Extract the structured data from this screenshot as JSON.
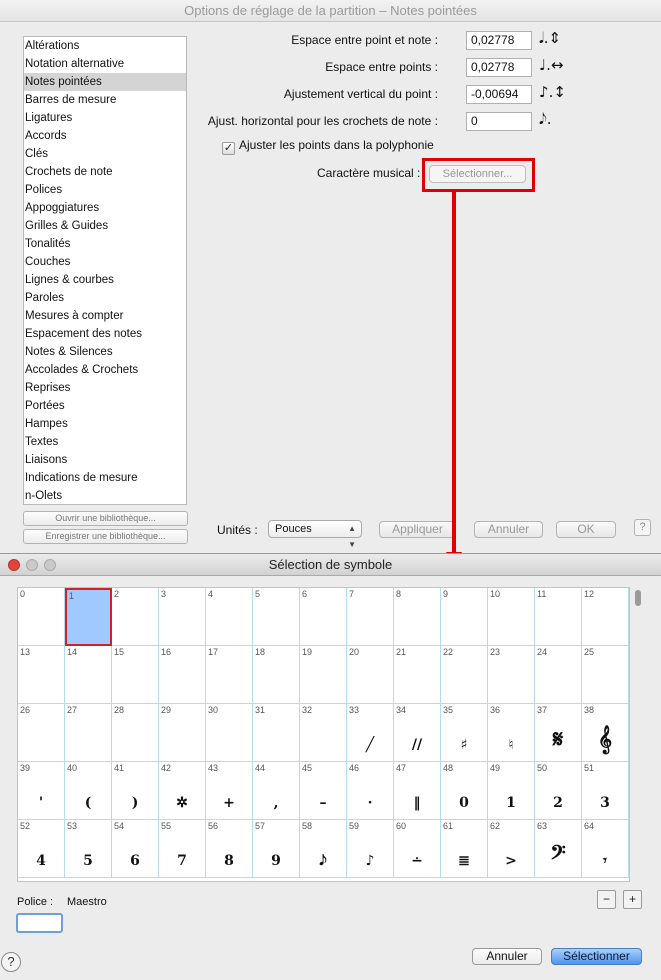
{
  "options_window": {
    "title": "Options de réglage de la partition – Notes pointées",
    "categories": [
      "Altérations",
      "Notation alternative",
      "Notes pointées",
      "Barres de mesure",
      "Ligatures",
      "Accords",
      "Clés",
      "Crochets de note",
      "Polices",
      "Appoggiatures",
      "Grilles & Guides",
      "Tonalités",
      "Couches",
      "Lignes & courbes",
      "Paroles",
      "Mesures à compter",
      "Espacement des notes",
      "Notes & Silences",
      "Accolades & Crochets",
      "Reprises",
      "Portées",
      "Hampes",
      "Textes",
      "Liaisons",
      "Indications de mesure",
      "n-Olets"
    ],
    "selected_category": "Notes pointées",
    "library_open_label": "Ouvrir une bibliothèque...",
    "library_save_label": "Enregistrer une bibliothèque...",
    "fields": [
      {
        "label": "Espace entre point et note :",
        "value": "0,02778",
        "icon": "𝅘𝅥.⇕"
      },
      {
        "label": "Espace entre points :",
        "value": "0,02778",
        "icon": "♩.↔"
      },
      {
        "label": "Ajustement vertical du point :",
        "value": "-0,00694",
        "icon": "♪.↕"
      },
      {
        "label": "Ajust. horizontal pour les crochets de note :",
        "value": "0",
        "icon": "𝅘𝅥𝅮."
      }
    ],
    "checkbox_label": "Ajuster les points dans la polyphonie",
    "checkbox_checked": true,
    "musical_char_label": "Caractère musical :",
    "select_button_label": "Sélectionner...",
    "units_label": "Unités :",
    "units_value": "Pouces",
    "apply_label": "Appliquer",
    "cancel_label": "Annuler",
    "ok_label": "OK",
    "help_label": "?"
  },
  "symbol_window": {
    "title": "Sélection de symbole",
    "selected_cell": 1,
    "cells": [
      {
        "n": "0",
        "g": ""
      },
      {
        "n": "1",
        "g": ""
      },
      {
        "n": "2",
        "g": ""
      },
      {
        "n": "3",
        "g": ""
      },
      {
        "n": "4",
        "g": ""
      },
      {
        "n": "5",
        "g": ""
      },
      {
        "n": "6",
        "g": ""
      },
      {
        "n": "7",
        "g": ""
      },
      {
        "n": "8",
        "g": ""
      },
      {
        "n": "9",
        "g": ""
      },
      {
        "n": "10",
        "g": ""
      },
      {
        "n": "11",
        "g": ""
      },
      {
        "n": "12",
        "g": ""
      },
      {
        "n": "13",
        "g": ""
      },
      {
        "n": "14",
        "g": ""
      },
      {
        "n": "15",
        "g": ""
      },
      {
        "n": "16",
        "g": ""
      },
      {
        "n": "17",
        "g": ""
      },
      {
        "n": "18",
        "g": ""
      },
      {
        "n": "19",
        "g": ""
      },
      {
        "n": "20",
        "g": ""
      },
      {
        "n": "21",
        "g": ""
      },
      {
        "n": "22",
        "g": ""
      },
      {
        "n": "23",
        "g": ""
      },
      {
        "n": "24",
        "g": ""
      },
      {
        "n": "25",
        "g": ""
      },
      {
        "n": "26",
        "g": ""
      },
      {
        "n": "27",
        "g": ""
      },
      {
        "n": "28",
        "g": ""
      },
      {
        "n": "29",
        "g": ""
      },
      {
        "n": "30",
        "g": ""
      },
      {
        "n": "31",
        "g": ""
      },
      {
        "n": "32",
        "g": ""
      },
      {
        "n": "33",
        "g": "╱"
      },
      {
        "n": "34",
        "g": "//"
      },
      {
        "n": "35",
        "g": "♯"
      },
      {
        "n": "36",
        "g": "♮"
      },
      {
        "n": "37",
        "g": "𝄋"
      },
      {
        "n": "38",
        "g": "𝄞"
      },
      {
        "n": "39",
        "g": "'"
      },
      {
        "n": "40",
        "g": "("
      },
      {
        "n": "41",
        "g": ")"
      },
      {
        "n": "42",
        "g": "✲"
      },
      {
        "n": "43",
        "g": "+"
      },
      {
        "n": "44",
        "g": ","
      },
      {
        "n": "45",
        "g": "–"
      },
      {
        "n": "46",
        "g": "·"
      },
      {
        "n": "47",
        "g": "‖"
      },
      {
        "n": "48",
        "g": "0"
      },
      {
        "n": "49",
        "g": "1"
      },
      {
        "n": "50",
        "g": "2"
      },
      {
        "n": "51",
        "g": "3"
      },
      {
        "n": "52",
        "g": "4"
      },
      {
        "n": "53",
        "g": "5"
      },
      {
        "n": "54",
        "g": "6"
      },
      {
        "n": "55",
        "g": "7"
      },
      {
        "n": "56",
        "g": "8"
      },
      {
        "n": "57",
        "g": "9"
      },
      {
        "n": "58",
        "g": "𝅘𝅥𝅮"
      },
      {
        "n": "59",
        "g": "♪"
      },
      {
        "n": "60",
        "g": "∸"
      },
      {
        "n": "61",
        "g": "≣"
      },
      {
        "n": "62",
        "g": ">"
      },
      {
        "n": "63",
        "g": "𝄢"
      },
      {
        "n": "64",
        "g": "𝄾"
      }
    ],
    "font_label": "Police :",
    "font_value": "Maestro",
    "zoom_out_icon": "🔍",
    "zoom_in_icon": "🔍",
    "cancel_label": "Annuler",
    "select_label": "Sélectionner",
    "help_label": "?"
  }
}
